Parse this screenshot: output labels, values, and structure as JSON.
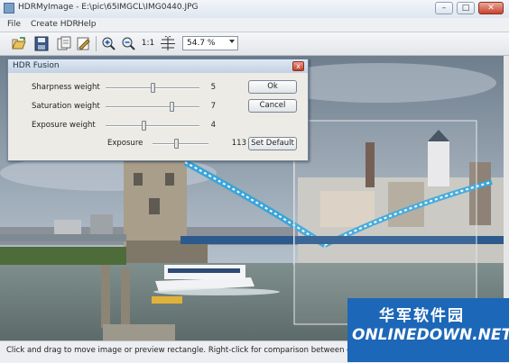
{
  "window": {
    "title": "HDRMyImage - E:\\pic\\65IMGCL\\IMG0440.JPG",
    "icon": "app-icon",
    "controls": [
      "minimize",
      "maximize",
      "close"
    ]
  },
  "menu": [
    "File",
    "Create HDR",
    "Help"
  ],
  "toolbar": {
    "icons": [
      "open-icon",
      "save-icon",
      "copy-icon",
      "edit-icon",
      "zoom-in-icon",
      "zoom-out-icon",
      "actual-size-icon",
      "fit-window-icon"
    ],
    "actual_size_label": "1:1",
    "zoom_value": "54.7 %"
  },
  "dialog": {
    "title": "HDR Fusion",
    "rows": [
      {
        "label": "Sharpness weight",
        "value": "5",
        "level": 0.5
      },
      {
        "label": "Saturation weight",
        "value": "7",
        "level": 0.7
      },
      {
        "label": "Exposure weight",
        "value": "4",
        "level": 0.4
      },
      {
        "label": "Exposure",
        "value": "113",
        "level": 0.42
      }
    ],
    "buttons": {
      "ok": "Ok",
      "cancel": "Cancel",
      "set_default": "Set Default"
    },
    "close_glyph": "x"
  },
  "status": "Click and drag to move image or preview rectangle. Right-click for comparison between original",
  "watermark": {
    "cn": "华军软件园",
    "en": "ONLINEDOWN.NET"
  }
}
